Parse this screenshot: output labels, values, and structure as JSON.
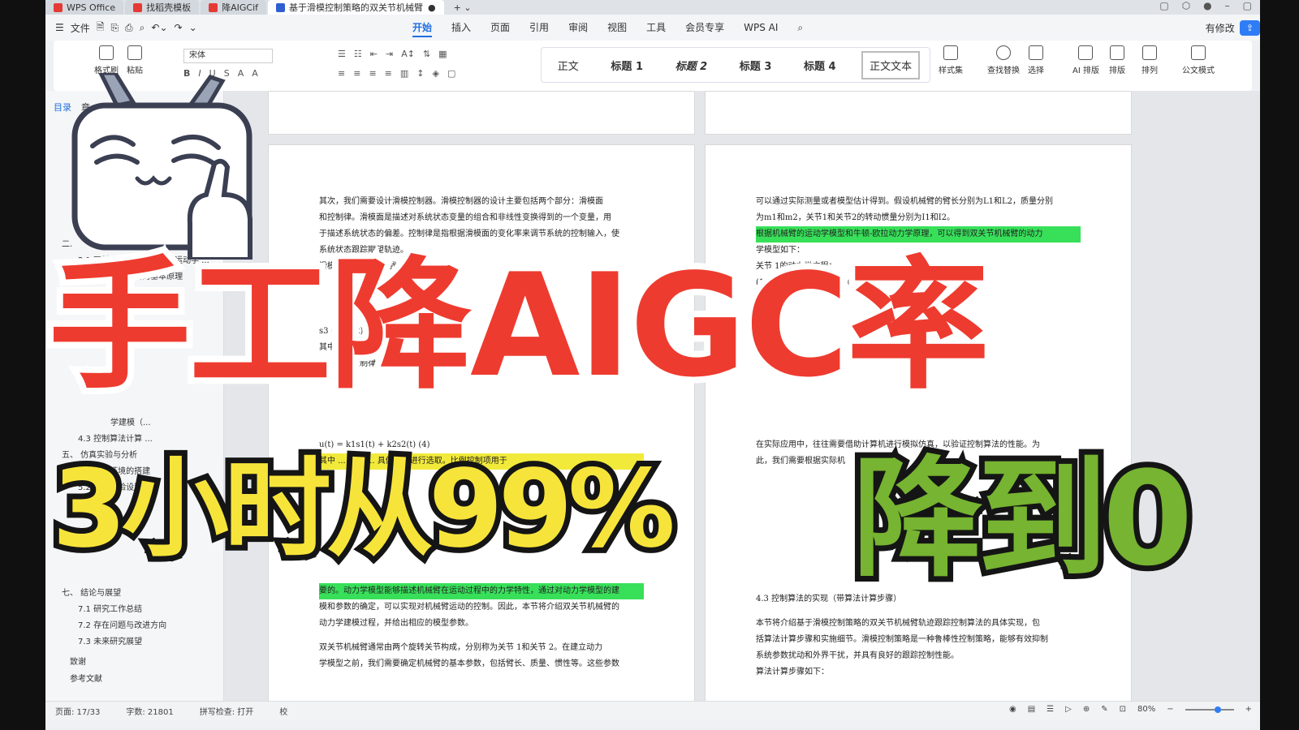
{
  "tabs": [
    {
      "label": "WPS Office",
      "color": "#e53935"
    },
    {
      "label": "找稻壳模板",
      "color": "#e53935"
    },
    {
      "label": "降AIGCif",
      "color": "#e53935"
    },
    {
      "label": "基于滑模控制策略的双关节机械臂",
      "color": "#2f5fd0"
    }
  ],
  "menu": {
    "file": "文件",
    "items": [
      "开始",
      "插入",
      "页面",
      "引用",
      "审阅",
      "视图",
      "工具",
      "会员专享",
      "WPS AI"
    ],
    "active": "开始",
    "revise": "有修改"
  },
  "ribbon": {
    "font": "宋体",
    "groups": [
      "格式刷",
      "粘贴"
    ],
    "styles": [
      "正文",
      "标题 1",
      "标题 2",
      "标题 3",
      "标题 4",
      "正文文本"
    ],
    "right_groups": [
      "样式集",
      "查找替换",
      "选择",
      "AI 排版",
      "排版",
      "排列",
      "公文模式"
    ]
  },
  "sidebar": {
    "tabs": [
      "目录",
      "章"
    ],
    "toc": [
      "二.",
      "2.1 双关节机械臂的结构与运动学 ...",
      "2.2 轨迹跟踪控制的基本原理",
      "学建模（...",
      "4.3 控制算法计算 ...",
      "五、 仿真实验与分析",
      "5.1 仿真环境的搭建",
      "5.2 仿真实验设置（...",
      "6.",
      "七、 结论与展望",
      "7.1 研究工作总结",
      "7.2 存在问题与改进方向",
      "7.3 未来研究展望",
      "致谢",
      "参考文献"
    ]
  },
  "left_page": [
    "其次，我们需要设计滑模控制器。滑模控制器的设计主要包括两个部分：滑模面",
    "和控制律。滑模面是描述对系统状态变量的组合和非线性变换得到的一个变量，用",
    "于描述系统状态的偏差。控制律是指根据滑模面的变化率来调节系统的控制输入，使",
    "系统状态跟踪期望轨迹。",
    "滑模面的设计可 ... 我们选择采用误差",
    "s3 = d²e(t)/d",
    "其中，e(t)为系",
    "息来设计控制律",
    "u(t) = k1s1(t) + k2s2(t)    (4)",
    "其中 ... 为控 ... 具体情况进行选取。比例控制项用于",
    "要的。动力学模型能够描述机械臂在运动过程中的力学特性，通过对动力学模型的建",
    "模和参数的确定，可以实现对机械臂运动的控制。因此，本节将介绍双关节机械臂的",
    "动力学建模过程，并给出相应的模型参数。",
    "双关节机械臂通常由两个旋转关节构成，分别称为关节 1和关节 2。在建立动力",
    "学模型之前，我们需要确定机械臂的基本参数，包括臂长、质量、惯性等。这些参数"
  ],
  "right_page": [
    "可以通过实际测量或者模型估计得到。假设机械臂的臂长分别为L1和L2，质量分别",
    "为m1和m2，关节1和关节2的转动惯量分别为I1和I2。",
    "根据机械臂的运动学模型和牛顿-欧拉动力学原理，可以得到双关节机械臂的动力",
    "学模型如下：",
    "关节 1的动力学方程：",
    "(1) I1 * θ1'' ... ² θ1'' + (m1 ... s * L2)",
    "m(θ1)",
    "在实际应用中，往往需要借助计算机进行模拟仿真，以验证控制算法的性能。为",
    "此，我们需要根据实际机",
    "4.3 控制算法的实现（带算法计算步骤）",
    "本节将介绍基于滑模控制策略的双关节机械臂轨迹跟踪控制算法的具体实现，包",
    "括算法计算步骤和实施细节。滑模控制策略是一种鲁棒性控制策略，能够有效抑制",
    "系统参数扰动和外界干扰，并具有良好的跟踪控制性能。",
    "算法计算步骤如下："
  ],
  "status": {
    "page": "页面: 17/33",
    "words": "字数: 21801",
    "spell": "拼写检查: 打开",
    "proof": "校",
    "zoom": "80%"
  },
  "overlay": {
    "line1": "手工降AIGC率",
    "line2a": "3小时从99%",
    "line2b": "降到0"
  },
  "colors": {
    "red": "#ee3b2f",
    "yellow": "#f7e43a",
    "green": "#76b431",
    "accent": "#1f6fe0"
  }
}
